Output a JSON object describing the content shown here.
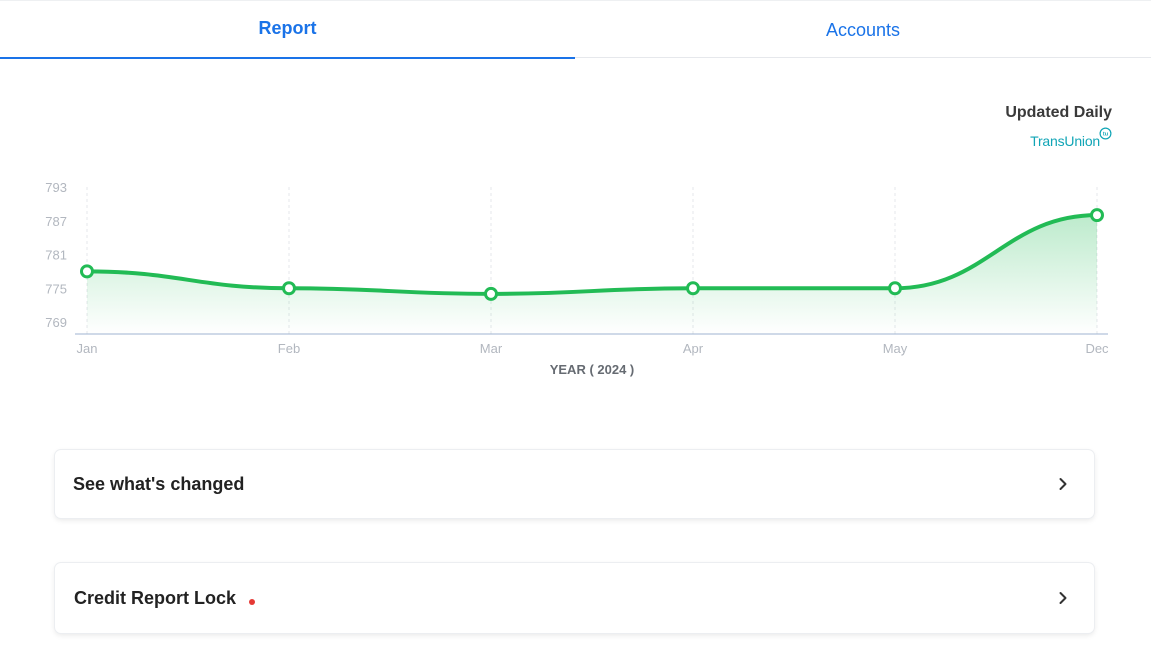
{
  "tabs": [
    {
      "label": "Report",
      "active": true
    },
    {
      "label": "Accounts",
      "active": false
    }
  ],
  "updated_label": "Updated Daily",
  "bureau": {
    "name": "TransUnion",
    "icon": "transunion-logo-icon"
  },
  "colors": {
    "accent": "#1a73e8",
    "line": "#22bb55",
    "bureau": "#11a5b6",
    "alert_dot": "#e53935"
  },
  "chart_data": {
    "type": "area",
    "categories": [
      "Jan",
      "Feb",
      "Mar",
      "Apr",
      "May",
      "Dec"
    ],
    "values": [
      778,
      775,
      774,
      775,
      775,
      788
    ],
    "y_ticks": [
      793,
      787,
      781,
      775,
      769
    ],
    "ylim": [
      767,
      793
    ],
    "xlabel": "YEAR ( 2024 )",
    "ylabel": "",
    "grid": "vertical-dashed"
  },
  "cards": [
    {
      "label": "See what's changed",
      "icon": "chevron-right-icon"
    },
    {
      "label": "Credit Report Lock",
      "icon": "chevron-right-icon",
      "alert": true
    }
  ]
}
